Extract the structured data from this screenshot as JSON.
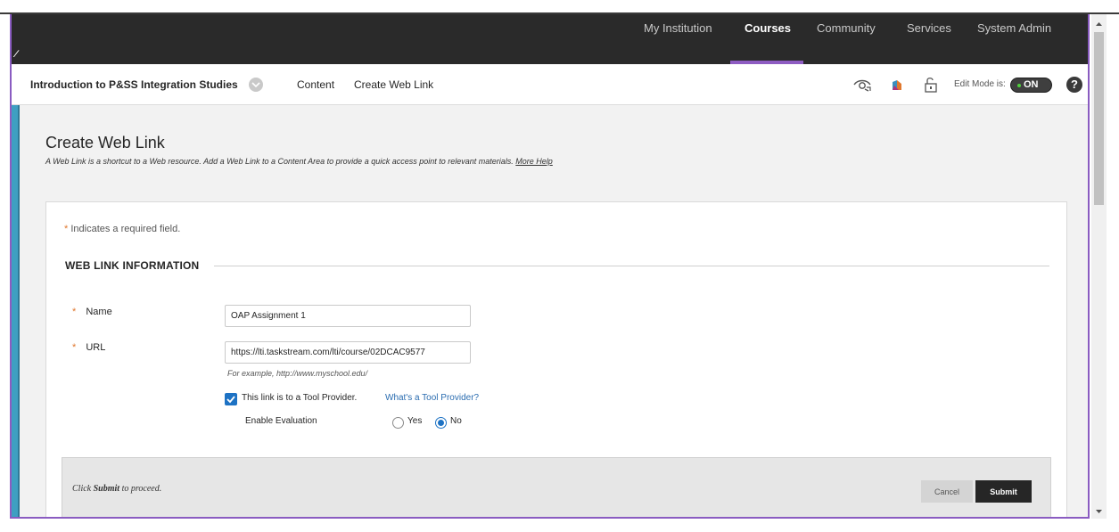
{
  "topnav": {
    "items": [
      "My Institution",
      "Courses",
      "Community",
      "Services",
      "System Admin"
    ],
    "active": "Courses"
  },
  "coursebar": {
    "course_title": "Introduction to P&SS Integration Studies",
    "crumbs": [
      "Content",
      "Create Web Link"
    ],
    "edit_mode_label": "Edit Mode is:",
    "edit_mode_state": "ON",
    "help_label": "?"
  },
  "page": {
    "title": "Create Web Link",
    "description": "A Web Link is a shortcut to a Web resource. Add a Web Link to a Content Area to provide a quick access point to relevant materials.",
    "more_help": "More Help"
  },
  "form": {
    "required_star": "*",
    "required_note": "Indicates a required field.",
    "section_heading": "WEB LINK INFORMATION",
    "name_label": "Name",
    "name_value": "OAP Assignment 1",
    "url_label": "URL",
    "url_value": "https://lti.taskstream.com/lti/course/02DCAC9577",
    "url_hint": "For example, http://www.myschool.edu/",
    "tool_provider_label": "This link is to a Tool Provider.",
    "tool_provider_checked": true,
    "tool_provider_link": "What's a Tool Provider?",
    "evaluation_label": "Enable Evaluation",
    "evaluation_options": [
      "Yes",
      "No"
    ],
    "evaluation_selected": "No"
  },
  "submit_bar": {
    "prefix": "Click",
    "emphasis": "Submit",
    "suffix": "to proceed.",
    "cancel_label": "Cancel",
    "submit_label": "Submit"
  },
  "colors": {
    "accent_purple": "#8e5cc2",
    "nav_background": "#2a2a2a",
    "left_strip": "#3e9fc2",
    "required_star": "#e0782e",
    "link_blue": "#2a6cb0",
    "checkbox_blue": "#1d72c4"
  }
}
